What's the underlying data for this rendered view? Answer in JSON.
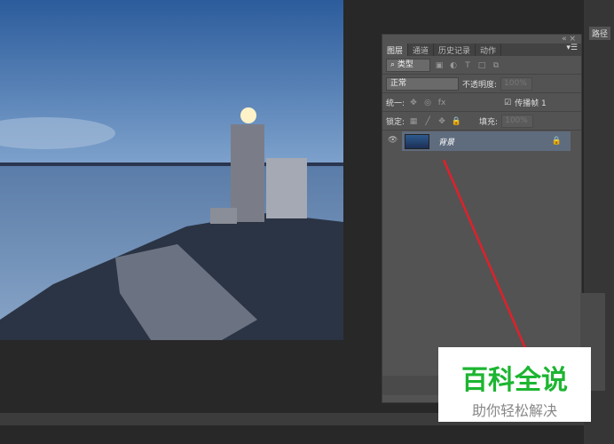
{
  "panel": {
    "tabs": [
      "图层",
      "通道",
      "历史记录",
      "动作"
    ],
    "filter": "类型",
    "blend_mode": "正常",
    "opacity_label": "不透明度:",
    "opacity": "100%",
    "unify_label": "统一:",
    "propagate_label": "传播帧 1",
    "lock_label": "锁定:",
    "fill_label": "填充:",
    "fill": "100%",
    "layers": [
      {
        "name": "背景"
      }
    ]
  },
  "right": {
    "paths_tab": "路径"
  },
  "watermark": {
    "title": "百科全说",
    "subtitle": "助你轻松解决"
  },
  "colors": {
    "annotation": "#e0202a",
    "watermark_green": "#1db531"
  }
}
